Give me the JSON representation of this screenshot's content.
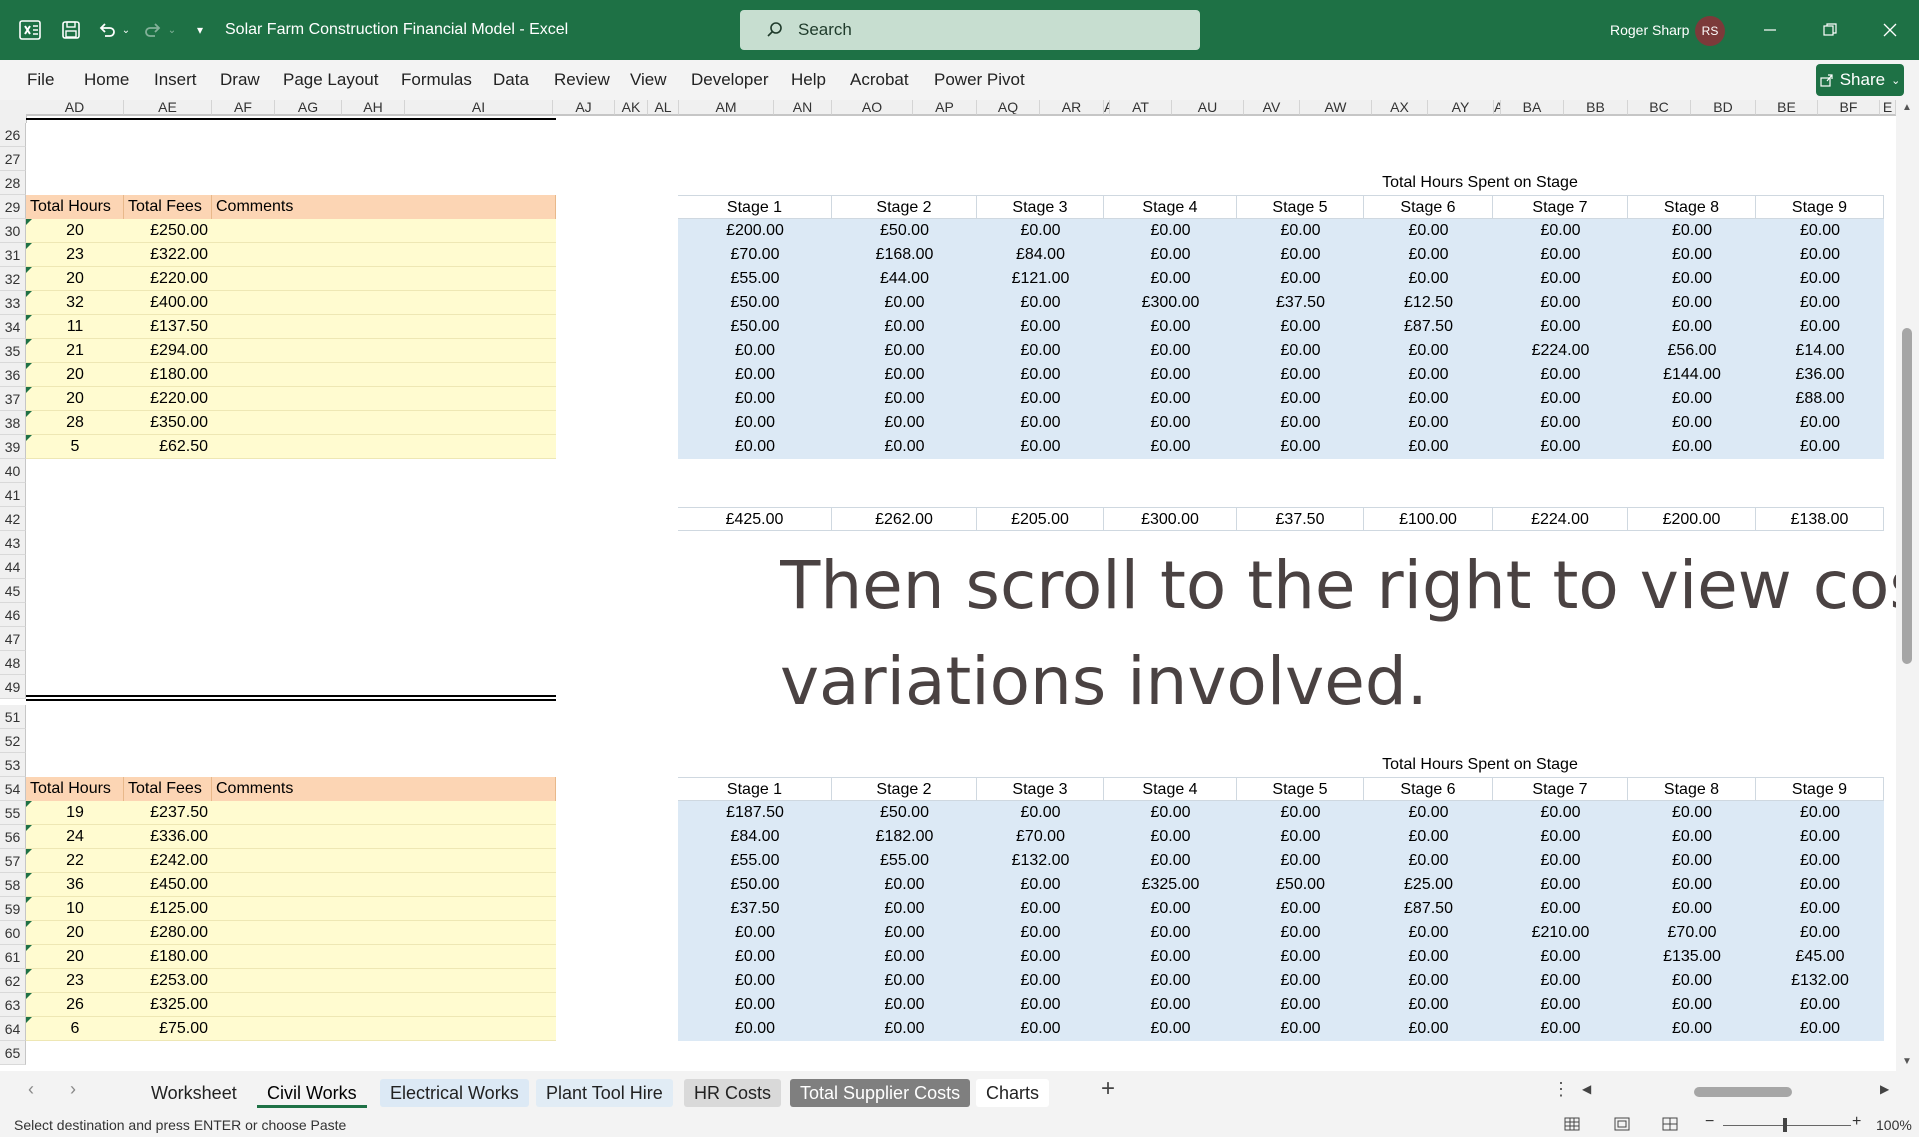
{
  "app": {
    "title": "Solar Farm Construction Financial Model  -  Excel",
    "search_placeholder": "Search",
    "user_name": "Roger Sharp",
    "user_initials": "RS"
  },
  "ribbon": {
    "tabs": [
      "File",
      "Home",
      "Insert",
      "Draw",
      "Page Layout",
      "Formulas",
      "Data",
      "Review",
      "View",
      "Developer",
      "Help",
      "Acrobat",
      "Power Pivot"
    ],
    "share_label": "Share"
  },
  "grid": {
    "columns": [
      "AD",
      "AE",
      "AF",
      "AG",
      "AH",
      "AI",
      "AJ",
      "AK",
      "AL",
      "AM",
      "AN",
      "AO",
      "AP",
      "AQ",
      "AR",
      "A",
      "AT",
      "AU",
      "AV",
      "AW",
      "AX",
      "AY",
      "A",
      "BA",
      "BB",
      "BC",
      "BD",
      "BE",
      "BF",
      "E"
    ],
    "rows": [
      "26",
      "27",
      "28",
      "29",
      "30",
      "31",
      "32",
      "33",
      "34",
      "35",
      "36",
      "37",
      "38",
      "39",
      "40",
      "41",
      "42",
      "43",
      "44",
      "45",
      "46",
      "47",
      "48",
      "49",
      "51",
      "52",
      "53",
      "54",
      "55",
      "56",
      "57",
      "58",
      "59",
      "60",
      "61",
      "62",
      "63",
      "64",
      "65"
    ],
    "left_headers": [
      "Total Hours",
      "Total Fees",
      "Comments"
    ],
    "right_title": "Total Hours Spent on Stage",
    "stages": [
      "Stage 1",
      "Stage 2",
      "Stage 3",
      "Stage 4",
      "Stage 5",
      "Stage 6",
      "Stage 7",
      "Stage 8",
      "Stage 9"
    ],
    "block1": {
      "hours": [
        "20",
        "23",
        "20",
        "32",
        "11",
        "21",
        "20",
        "20",
        "28",
        "5"
      ],
      "fees": [
        "£250.00",
        "£322.00",
        "£220.00",
        "£400.00",
        "£137.50",
        "£294.00",
        "£180.00",
        "£220.00",
        "£350.00",
        "£62.50"
      ],
      "stage_rows": [
        [
          "£200.00",
          "£50.00",
          "£0.00",
          "£0.00",
          "£0.00",
          "£0.00",
          "£0.00",
          "£0.00",
          "£0.00"
        ],
        [
          "£70.00",
          "£168.00",
          "£84.00",
          "£0.00",
          "£0.00",
          "£0.00",
          "£0.00",
          "£0.00",
          "£0.00"
        ],
        [
          "£55.00",
          "£44.00",
          "£121.00",
          "£0.00",
          "£0.00",
          "£0.00",
          "£0.00",
          "£0.00",
          "£0.00"
        ],
        [
          "£50.00",
          "£0.00",
          "£0.00",
          "£300.00",
          "£37.50",
          "£12.50",
          "£0.00",
          "£0.00",
          "£0.00"
        ],
        [
          "£50.00",
          "£0.00",
          "£0.00",
          "£0.00",
          "£0.00",
          "£87.50",
          "£0.00",
          "£0.00",
          "£0.00"
        ],
        [
          "£0.00",
          "£0.00",
          "£0.00",
          "£0.00",
          "£0.00",
          "£0.00",
          "£224.00",
          "£56.00",
          "£14.00"
        ],
        [
          "£0.00",
          "£0.00",
          "£0.00",
          "£0.00",
          "£0.00",
          "£0.00",
          "£0.00",
          "£144.00",
          "£36.00"
        ],
        [
          "£0.00",
          "£0.00",
          "£0.00",
          "£0.00",
          "£0.00",
          "£0.00",
          "£0.00",
          "£0.00",
          "£88.00"
        ],
        [
          "£0.00",
          "£0.00",
          "£0.00",
          "£0.00",
          "£0.00",
          "£0.00",
          "£0.00",
          "£0.00",
          "£0.00"
        ],
        [
          "£0.00",
          "£0.00",
          "£0.00",
          "£0.00",
          "£0.00",
          "£0.00",
          "£0.00",
          "£0.00",
          "£0.00"
        ]
      ],
      "totals": [
        "£425.00",
        "£262.00",
        "£205.00",
        "£300.00",
        "£37.50",
        "£100.00",
        "£224.00",
        "£200.00",
        "£138.00"
      ]
    },
    "block2": {
      "hours": [
        "19",
        "24",
        "22",
        "36",
        "10",
        "20",
        "20",
        "23",
        "26",
        "6"
      ],
      "fees": [
        "£237.50",
        "£336.00",
        "£242.00",
        "£450.00",
        "£125.00",
        "£280.00",
        "£180.00",
        "£253.00",
        "£325.00",
        "£75.00"
      ],
      "stage_rows": [
        [
          "£187.50",
          "£50.00",
          "£0.00",
          "£0.00",
          "£0.00",
          "£0.00",
          "£0.00",
          "£0.00",
          "£0.00"
        ],
        [
          "£84.00",
          "£182.00",
          "£70.00",
          "£0.00",
          "£0.00",
          "£0.00",
          "£0.00",
          "£0.00",
          "£0.00"
        ],
        [
          "£55.00",
          "£55.00",
          "£132.00",
          "£0.00",
          "£0.00",
          "£0.00",
          "£0.00",
          "£0.00",
          "£0.00"
        ],
        [
          "£50.00",
          "£0.00",
          "£0.00",
          "£325.00",
          "£50.00",
          "£25.00",
          "£0.00",
          "£0.00",
          "£0.00"
        ],
        [
          "£37.50",
          "£0.00",
          "£0.00",
          "£0.00",
          "£0.00",
          "£87.50",
          "£0.00",
          "£0.00",
          "£0.00"
        ],
        [
          "£0.00",
          "£0.00",
          "£0.00",
          "£0.00",
          "£0.00",
          "£0.00",
          "£210.00",
          "£70.00",
          "£0.00"
        ],
        [
          "£0.00",
          "£0.00",
          "£0.00",
          "£0.00",
          "£0.00",
          "£0.00",
          "£0.00",
          "£135.00",
          "£45.00"
        ],
        [
          "£0.00",
          "£0.00",
          "£0.00",
          "£0.00",
          "£0.00",
          "£0.00",
          "£0.00",
          "£0.00",
          "£132.00"
        ],
        [
          "£0.00",
          "£0.00",
          "£0.00",
          "£0.00",
          "£0.00",
          "£0.00",
          "£0.00",
          "£0.00",
          "£0.00"
        ],
        [
          "£0.00",
          "£0.00",
          "£0.00",
          "£0.00",
          "£0.00",
          "£0.00",
          "£0.00",
          "£0.00",
          "£0.00"
        ]
      ]
    },
    "overlay_line1": "Then scroll to the right to view cost",
    "overlay_line2": "variations involved."
  },
  "sheet_tabs": [
    "Worksheet",
    "Civil Works",
    "Electrical Works",
    "Plant Tool Hire",
    "HR Costs",
    "Total Supplier Costs",
    "Charts"
  ],
  "active_sheet": "Civil Works",
  "status": {
    "message": "Select destination and press ENTER or choose Paste",
    "zoom": "100%"
  },
  "colors": {
    "excel_green": "#1e7145",
    "header_orange": "#fcd5b4",
    "yellow": "#fffbd0",
    "blue": "#dce9f5"
  }
}
